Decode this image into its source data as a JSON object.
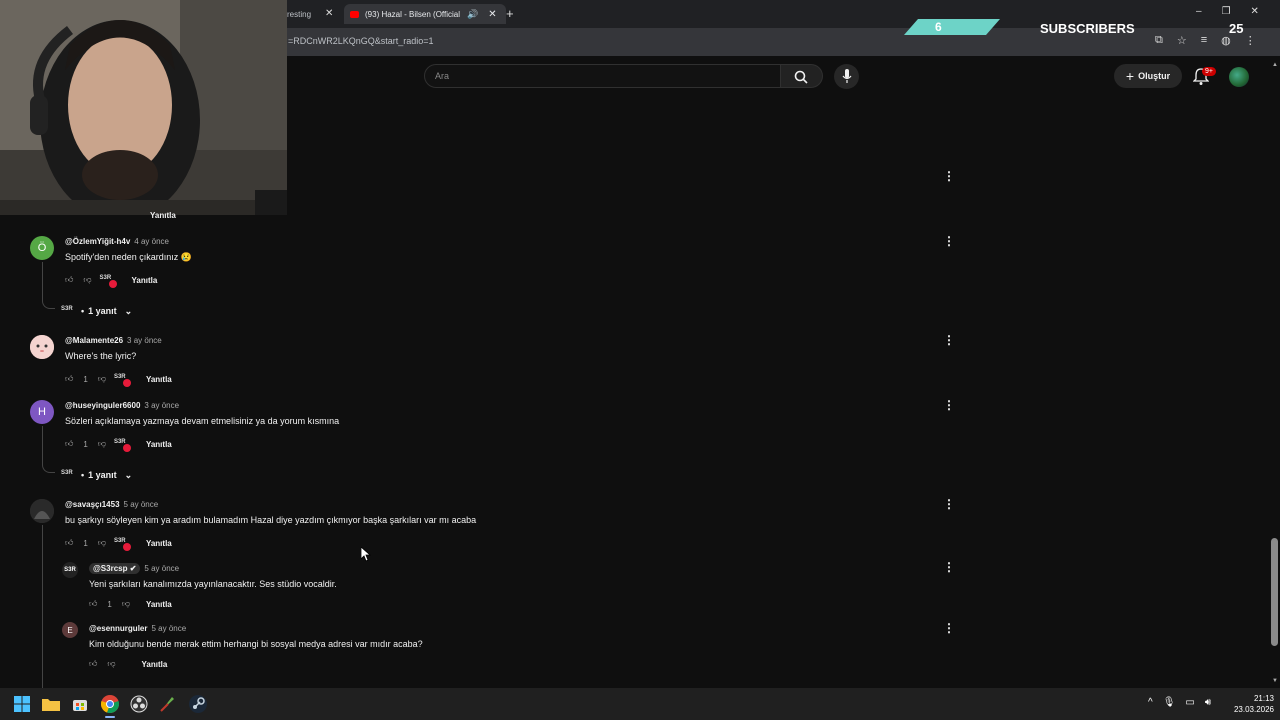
{
  "browser": {
    "tabs": [
      {
        "title": "resting"
      },
      {
        "title": "(93) Hazal - Bilsen (Official"
      }
    ],
    "url": "=RDCnWR2LKQnGQ&start_radio=1"
  },
  "overlay": {
    "subscriber_count": "6",
    "subscribers_label": "SUBSCRIBERS",
    "subscriber_goal": "25"
  },
  "youtube_header": {
    "search_placeholder": "Ara",
    "create_label": "Oluştur",
    "notification_badge": "9+"
  },
  "comments": [
    {
      "author": "@ÖzlemYiğit-h4v",
      "time": "4 ay önce",
      "text": "Spotify'den neden çıkardınız 😢",
      "likes": "",
      "reply_label": "Yanıtla",
      "replies_toggle": "1 yanıt",
      "avatar_letter": "Ö",
      "avatar_color": "#55a845"
    },
    {
      "author": "@Malamente26",
      "time": "3 ay önce",
      "text": "Where's the lyric?",
      "likes": "1",
      "reply_label": "Yanıtla",
      "avatar_color": "#f2c6c6"
    },
    {
      "author": "@huseyinguler6600",
      "time": "3 ay önce",
      "text": "Sözleri açıklamaya yazmaya devam etmelisiniz ya da yorum kısmına",
      "likes": "1",
      "reply_label": "Yanıtla",
      "replies_toggle": "1 yanıt",
      "avatar_letter": "H",
      "avatar_color": "#7e57c2"
    },
    {
      "author": "@savaşçı1453",
      "time": "5 ay önce",
      "text": "bu şarkıyı söyleyen kim ya aradım bulamadım Hazal diye yazdım çıkmıyor başka şarkıları var mı acaba",
      "likes": "1",
      "reply_label": "Yanıtla",
      "avatar_color": "#333333"
    }
  ],
  "replies": [
    {
      "author": "@S3rcsp",
      "time": "5 ay önce",
      "text": "Yeni şarkıları kanalımızda yayınlanacaktır. Ses stüdio vocaldir.",
      "likes": "1",
      "reply_label": "Yanıtla"
    },
    {
      "author": "@esennurguler",
      "time": "5 ay önce",
      "text": "Kim olduğunu bende merak ettim herhangi bi sosyal medya adresi var mıdır acaba?",
      "likes": "",
      "reply_label": "Yanıtla",
      "avatar_letter": "E",
      "avatar_color": "#5d3a3a"
    }
  ],
  "partial_top_reply_label": "Yanıtla",
  "taskbar": {
    "time": "21:13",
    "date": "23.03.2026"
  },
  "colors": {
    "background": "#0f0f0f",
    "accent_heart": "#e61b3a",
    "overlay_teal": "#6dd3c7"
  }
}
